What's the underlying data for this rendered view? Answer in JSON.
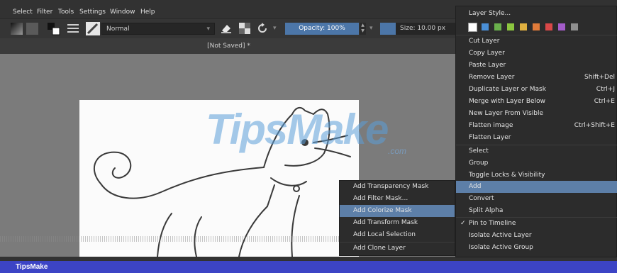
{
  "menubar": {
    "items": [
      "Select",
      "Filter",
      "Tools",
      "Settings",
      "Window",
      "Help"
    ]
  },
  "toolbar": {
    "blend_mode": "Normal",
    "opacity": "Opacity: 100%",
    "size": "Size: 10.00 px"
  },
  "document": {
    "title": "[Not Saved] *"
  },
  "watermark": {
    "text": "TipsMake",
    "suffix": ".com"
  },
  "context_menu": {
    "items": [
      {
        "label": "Layer Style...",
        "shortcut": ""
      },
      {
        "label": "Cut Layer",
        "shortcut": ""
      },
      {
        "label": "Copy Layer",
        "shortcut": ""
      },
      {
        "label": "Paste Layer",
        "shortcut": ""
      },
      {
        "label": "Remove Layer",
        "shortcut": "Shift+Del"
      },
      {
        "label": "Duplicate Layer or Mask",
        "shortcut": "Ctrl+J"
      },
      {
        "label": "Merge with Layer Below",
        "shortcut": "Ctrl+E"
      },
      {
        "label": "New Layer From Visible",
        "shortcut": ""
      },
      {
        "label": "Flatten image",
        "shortcut": "Ctrl+Shift+E"
      },
      {
        "label": "Flatten Layer",
        "shortcut": ""
      },
      {
        "label": "Select",
        "shortcut": ""
      },
      {
        "label": "Group",
        "shortcut": ""
      },
      {
        "label": "Toggle Locks & Visibility",
        "shortcut": ""
      },
      {
        "label": "Add",
        "shortcut": ""
      },
      {
        "label": "Convert",
        "shortcut": ""
      },
      {
        "label": "Split Alpha",
        "shortcut": ""
      },
      {
        "label": "Pin to Timeline",
        "shortcut": ""
      },
      {
        "label": "Isolate Active Layer",
        "shortcut": ""
      },
      {
        "label": "Isolate Active Group",
        "shortcut": ""
      }
    ],
    "checkmark": "✓",
    "color_labels": [
      "#ffffff",
      "#4a8fd6",
      "#6ab04c",
      "#8cc63f",
      "#e0b040",
      "#e07b3a",
      "#d94848",
      "#a35cc9",
      "#8f8f8f"
    ]
  },
  "add_submenu": {
    "items": [
      "Add Transparency Mask",
      "Add Filter Mask...",
      "Add Colorize Mask",
      "Add Transform Mask",
      "Add Local Selection",
      "Add Clone Layer"
    ]
  },
  "status": {
    "brand": "TipsMake"
  },
  "icons": [
    "color-swatch-icon",
    "pattern-icon",
    "brush-preset-icon",
    "eraser-icon",
    "reload-icon",
    "alpha-lock-icon",
    "spinner-icon"
  ]
}
